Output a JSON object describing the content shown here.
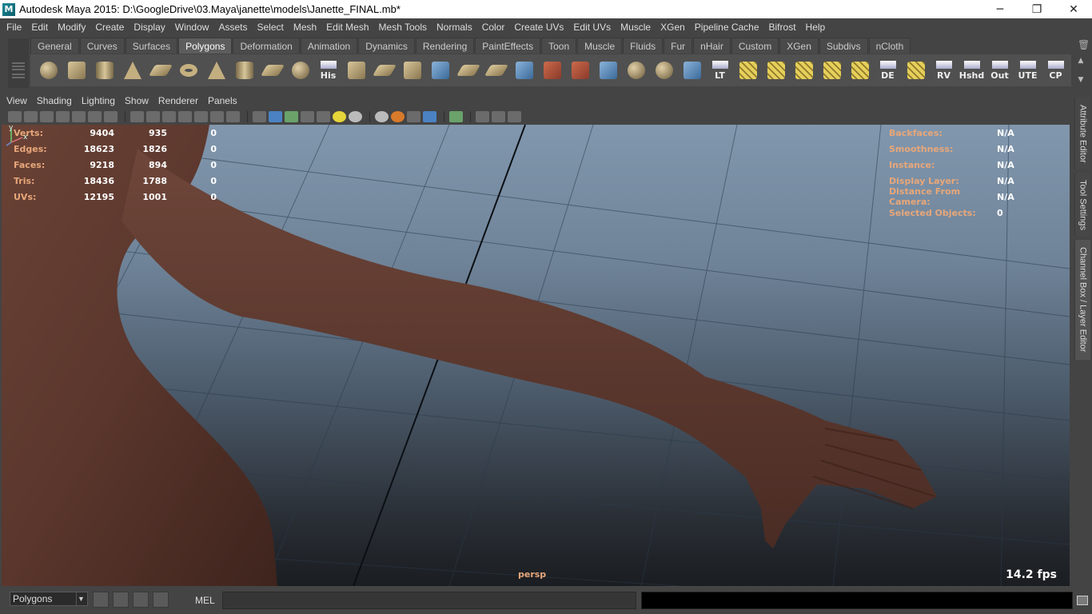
{
  "window": {
    "title": "Autodesk Maya 2015: D:\\GoogleDrive\\03.Maya\\janette\\models\\Janette_FINAL.mb*",
    "minimize": "─",
    "restore": "❐",
    "close": "✕"
  },
  "menu": [
    "File",
    "Edit",
    "Modify",
    "Create",
    "Display",
    "Window",
    "Assets",
    "Select",
    "Mesh",
    "Edit Mesh",
    "Mesh Tools",
    "Normals",
    "Color",
    "Create UVs",
    "Edit UVs",
    "Muscle",
    "XGen",
    "Pipeline Cache",
    "Bifrost",
    "Help"
  ],
  "shelf": {
    "tabs": [
      "General",
      "Curves",
      "Surfaces",
      "Polygons",
      "Deformation",
      "Animation",
      "Dynamics",
      "Rendering",
      "PaintEffects",
      "Toon",
      "Muscle",
      "Fluids",
      "Fur",
      "nHair",
      "Custom",
      "XGen",
      "Subdivs",
      "nCloth"
    ],
    "active_tab": "Polygons",
    "icons": [
      {
        "name": "poly-sphere-icon",
        "kind": "sphere"
      },
      {
        "name": "poly-cube-icon",
        "kind": "cube"
      },
      {
        "name": "poly-cylinder-icon",
        "kind": "cyl"
      },
      {
        "name": "poly-cone-icon",
        "kind": "cone"
      },
      {
        "name": "poly-plane-icon",
        "kind": "plane"
      },
      {
        "name": "poly-torus-icon",
        "kind": "torus"
      },
      {
        "name": "poly-pyramid-icon",
        "kind": "cone"
      },
      {
        "name": "poly-pipe-icon",
        "kind": "cyl"
      },
      {
        "name": "create-polygon-icon",
        "kind": "plane"
      },
      {
        "name": "soccer-ball-icon",
        "kind": "sphere"
      },
      {
        "name": "history-icon",
        "kind": "text",
        "label": "His"
      },
      {
        "name": "extrude-icon",
        "kind": "cube"
      },
      {
        "name": "bridge-icon",
        "kind": "plane"
      },
      {
        "name": "bevel-icon",
        "kind": "cube"
      },
      {
        "name": "split-icon",
        "kind": "blue"
      },
      {
        "name": "insert-edgeloop-icon",
        "kind": "plane"
      },
      {
        "name": "merge-icon",
        "kind": "plane"
      },
      {
        "name": "uv-map-icon",
        "kind": "blue"
      },
      {
        "name": "sculpt-icon",
        "kind": "sel"
      },
      {
        "name": "paint-tool-icon",
        "kind": "sel"
      },
      {
        "name": "wireframe-icon",
        "kind": "blue"
      },
      {
        "name": "rotate-manipulator-icon",
        "kind": "sphere"
      },
      {
        "name": "universal-manipulator-icon",
        "kind": "sphere"
      },
      {
        "name": "snap-object-icon",
        "kind": "blue"
      },
      {
        "name": "lt-icon",
        "kind": "text",
        "label": "LT"
      },
      {
        "name": "select-edgeloop-icon",
        "kind": "yellow"
      },
      {
        "name": "select-edgering-icon",
        "kind": "yellow"
      },
      {
        "name": "select-border-icon",
        "kind": "yellow"
      },
      {
        "name": "select-shell-icon",
        "kind": "yellow"
      },
      {
        "name": "select-uv-icon",
        "kind": "yellow"
      },
      {
        "name": "display-edges-icon",
        "kind": "text",
        "label": "DE"
      },
      {
        "name": "grid-toggle-icon",
        "kind": "yellow"
      },
      {
        "name": "rv-icon",
        "kind": "text",
        "label": "RV"
      },
      {
        "name": "hshd-icon",
        "kind": "text",
        "label": "Hshd"
      },
      {
        "name": "out-icon",
        "kind": "text",
        "label": "Out"
      },
      {
        "name": "ute-icon",
        "kind": "text",
        "label": "UTE"
      },
      {
        "name": "cp-icon",
        "kind": "text",
        "label": "CP"
      }
    ]
  },
  "panel_menu": [
    "View",
    "Shading",
    "Lighting",
    "Show",
    "Renderer",
    "Panels"
  ],
  "hud_left": [
    {
      "label": "Verts:",
      "a": "9404",
      "b": "935",
      "c": "0"
    },
    {
      "label": "Edges:",
      "a": "18623",
      "b": "1826",
      "c": "0"
    },
    {
      "label": "Faces:",
      "a": "9218",
      "b": "894",
      "c": "0"
    },
    {
      "label": "Tris:",
      "a": "18436",
      "b": "1788",
      "c": "0"
    },
    {
      "label": "UVs:",
      "a": "12195",
      "b": "1001",
      "c": "0"
    }
  ],
  "hud_right": [
    {
      "label": "Backfaces:",
      "value": "N/A"
    },
    {
      "label": "Smoothness:",
      "value": "N/A"
    },
    {
      "label": "Instance:",
      "value": "N/A"
    },
    {
      "label": "Display Layer:",
      "value": "N/A"
    },
    {
      "label": "Distance From Camera:",
      "value": "N/A"
    },
    {
      "label": "Selected Objects:",
      "value": "0"
    }
  ],
  "viewport": {
    "camera": "persp",
    "fps": "14.2 fps",
    "axis_y": "y",
    "axis_x": "x"
  },
  "side_tabs": {
    "attribute_editor": "Attribute Editor",
    "tool_settings": "Tool Settings",
    "channel_box": "Channel Box / Layer Editor"
  },
  "bottom": {
    "mode": "Polygons",
    "mel_label": "MEL",
    "mel_input": ""
  }
}
